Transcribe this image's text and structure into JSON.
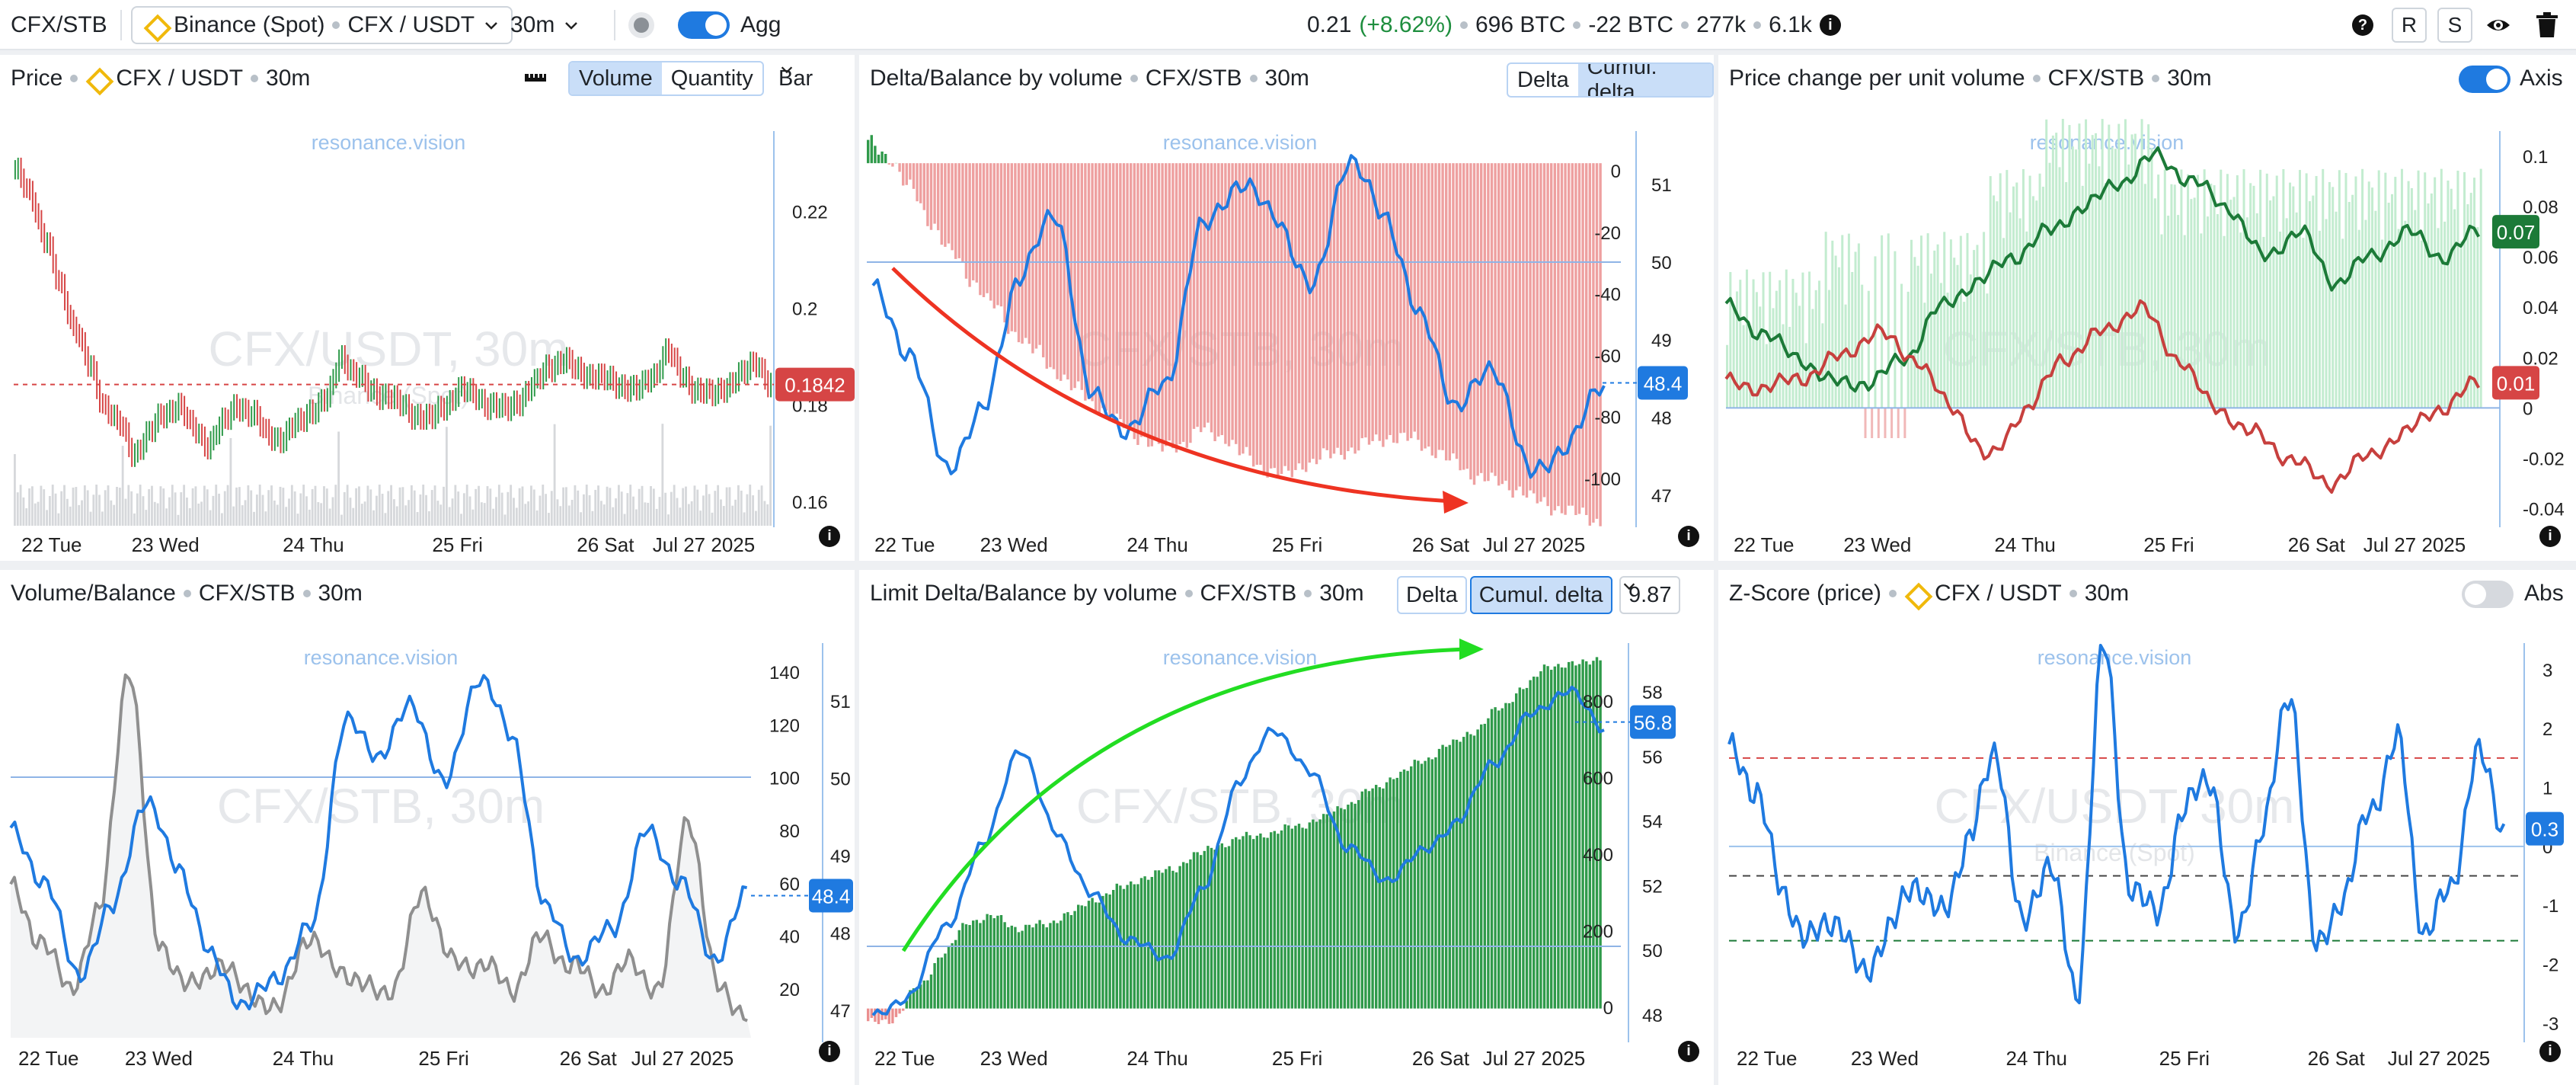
{
  "topbar": {
    "symbol": "CFX/STB",
    "exchange": "Binance (Spot)",
    "pair": "CFX / USDT",
    "timeframe": "30m",
    "agg_label": "Agg",
    "price": "0.21",
    "change": "(+8.62%)",
    "vol_btc": "696 BTC",
    "delta_btc": "-22 BTC",
    "trades": "277k",
    "oi": "6.1k",
    "btn_r": "R",
    "btn_s": "S",
    "help_icon": "?",
    "info_icon": "i",
    "colors": {
      "positive": "#1e8e3e",
      "accent": "#1f7ae0"
    }
  },
  "watermark": "resonance.vision",
  "panels": [
    {
      "id": "price",
      "title": "Price",
      "pair": "CFX / USDT",
      "tf": "30m",
      "buttons": [
        "Volume",
        "Quantity"
      ],
      "active_button": "Volume",
      "chart_type_label": "Bar",
      "bg_text": "CFX/USDT, 30m",
      "bg_sub": "Binance (Spot)",
      "price_tag": "0.1842"
    },
    {
      "id": "delta",
      "title": "Delta/Balance by volume",
      "pair": "CFX/STB",
      "tf": "30m",
      "buttons": [
        "Delta",
        "Cumul. delta"
      ],
      "active_button": "Cumul. delta",
      "bg_text": "CFX/STB, 30m",
      "value_tag": "48.4"
    },
    {
      "id": "pcu",
      "title": "Price change per unit volume",
      "pair": "CFX/STB",
      "tf": "30m",
      "toggle_label": "Axis",
      "bg_text": "CFX/STB, 30m",
      "tag_green": "0.07",
      "tag_red": "0.01"
    },
    {
      "id": "volbal",
      "title": "Volume/Balance",
      "pair": "CFX/STB",
      "tf": "30m",
      "bg_text": "CFX/STB, 30m",
      "value_tag": "48.4"
    },
    {
      "id": "limit",
      "title": "Limit Delta/Balance by volume",
      "pair": "CFX/STB",
      "tf": "30m",
      "buttons": [
        "Delta",
        "Cumul. delta"
      ],
      "active_button": "Cumul. delta",
      "dropdown": "9.87",
      "bg_text": "CFX/STB, 30m",
      "value_tag": "56.8"
    },
    {
      "id": "zscore",
      "title": "Z-Score (price)",
      "pair": "CFX / USDT",
      "tf": "30m",
      "toggle_label": "Abs",
      "bg_text": "CFX/USDT, 30m",
      "bg_sub": "Binance (Spot)",
      "value_tag": "0.3"
    }
  ],
  "chart_data": [
    {
      "type": "bar",
      "panel": "price",
      "x_ticks": [
        "22 Tue",
        "23 Wed",
        "24 Thu",
        "25 Fri",
        "26 Sat",
        "Jul 27 2025"
      ],
      "y_ticks": [
        "0.22",
        "0.2",
        "0.18",
        "0.16"
      ],
      "ylim": [
        0.155,
        0.235
      ],
      "series": [
        {
          "values": [
            0.228,
            0.224,
            0.214,
            0.205,
            0.196,
            0.188,
            0.18,
            0.176,
            0.17,
            0.174,
            0.178,
            0.18,
            0.175,
            0.172,
            0.176,
            0.18,
            0.178,
            0.174,
            0.173,
            0.176,
            0.179,
            0.181,
            0.19,
            0.186,
            0.183,
            0.182,
            0.18,
            0.178,
            0.177,
            0.18,
            0.183,
            0.182,
            0.18,
            0.179,
            0.181,
            0.184,
            0.188,
            0.189,
            0.187,
            0.186,
            0.185,
            0.184,
            0.183,
            0.186,
            0.191,
            0.186,
            0.183,
            0.182,
            0.184,
            0.186,
            0.189,
            0.184
          ]
        }
      ]
    },
    {
      "type": "bar",
      "panel": "delta",
      "x_ticks": [
        "22 Tue",
        "23 Wed",
        "24 Thu",
        "25 Fri",
        "26 Sat",
        "Jul 27 2025"
      ],
      "y_ticks_left": [
        "0",
        "-20",
        "-40",
        "-60",
        "-80",
        "-100"
      ],
      "y_ticks_right": [
        "51",
        "50",
        "49",
        "48",
        "47"
      ],
      "ylim": [
        -110,
        8
      ],
      "series": [
        {
          "values": [
            6,
            2,
            -8,
            -18,
            -28,
            -36,
            -44,
            -52,
            -58,
            -64,
            -70,
            -75,
            -80,
            -84,
            -88,
            -86,
            -82,
            -84,
            -90,
            -94,
            -96,
            -92,
            -90,
            -88,
            -86,
            -84,
            -85,
            -88,
            -92,
            -96,
            -98,
            -100,
            -104,
            -106,
            -108,
            -110
          ]
        },
        {
          "values": [
            49.6,
            48.8,
            47.3,
            48.0,
            49.8,
            50.6,
            48.2,
            47.8,
            48.4,
            50.4,
            51.0,
            50.6,
            49.6,
            51.3,
            50.6,
            49.2,
            48.1,
            48.6,
            47.2,
            47.6,
            48.4
          ]
        }
      ]
    },
    {
      "type": "line",
      "panel": "pcu",
      "x_ticks": [
        "22 Tue",
        "23 Wed",
        "24 Thu",
        "25 Fri",
        "26 Sat",
        "Jul 27 2025"
      ],
      "y_ticks": [
        "0.1",
        "0.08",
        "0.06",
        "0.04",
        "0.02",
        "0",
        "-0.02",
        "-0.04"
      ],
      "ylim": [
        -0.045,
        0.11
      ],
      "series": [
        {
          "values": [
            0.04,
            0.03,
            0.02,
            0.01,
            0.01,
            0.02,
            0.04,
            0.05,
            0.06,
            0.07,
            0.08,
            0.09,
            0.1,
            0.09,
            0.08,
            0.06,
            0.07,
            0.05,
            0.06,
            0.07,
            0.06,
            0.07
          ]
        },
        {
          "values": [
            0.01,
            0.008,
            0.012,
            0.02,
            0.03,
            0.02,
            0.0,
            -0.02,
            0.0,
            0.02,
            0.03,
            0.04,
            0.02,
            0.0,
            -0.01,
            -0.02,
            -0.03,
            -0.02,
            -0.01,
            0.0,
            0.01
          ]
        }
      ]
    },
    {
      "type": "line",
      "panel": "volbal",
      "x_ticks": [
        "22 Tue",
        "23 Wed",
        "24 Thu",
        "25 Fri",
        "26 Sat",
        "Jul 27 2025"
      ],
      "y_ticks_left": [
        "140",
        "120",
        "100",
        "80",
        "60",
        "40",
        "20"
      ],
      "y_ticks_right": [
        "51",
        "50",
        "49",
        "48",
        "47"
      ],
      "series": [
        {
          "values": [
            60,
            40,
            20,
            50,
            150,
            40,
            20,
            30,
            20,
            10,
            40,
            30,
            20,
            20,
            60,
            30,
            30,
            20,
            40,
            30,
            20,
            30,
            20,
            90,
            20,
            10
          ]
        },
        {
          "values": [
            49.2,
            48.6,
            47.4,
            48.2,
            49.6,
            48.8,
            47.6,
            47.0,
            47.4,
            48.0,
            50.6,
            50.2,
            50.8,
            49.8,
            51.2,
            50.4,
            48.2,
            47.6,
            48.0,
            49.2,
            48.6,
            47.6,
            48.4
          ]
        }
      ]
    },
    {
      "type": "bar",
      "panel": "limit",
      "x_ticks": [
        "22 Tue",
        "23 Wed",
        "24 Thu",
        "25 Fri",
        "26 Sat",
        "Jul 27 2025"
      ],
      "y_ticks_left": [
        "800",
        "600",
        "400",
        "200",
        "0"
      ],
      "y_ticks_right": [
        "58",
        "56",
        "54",
        "52",
        "50",
        "48"
      ],
      "ylim": [
        -80,
        1000
      ],
      "series": [
        {
          "values": [
            -40,
            -30,
            60,
            150,
            240,
            250,
            220,
            230,
            260,
            300,
            330,
            360,
            380,
            420,
            450,
            470,
            480,
            500,
            520,
            560,
            600,
            640,
            680,
            720,
            760,
            820,
            880,
            940,
            940,
            960
          ]
        },
        {
          "values": [
            47.8,
            48.5,
            50.6,
            53.0,
            56.0,
            53.5,
            51.5,
            50.2,
            49.6,
            51.6,
            55.0,
            56.6,
            55.2,
            53.0,
            52.0,
            52.8,
            53.8,
            55.6,
            57.0,
            57.8,
            56.6
          ]
        }
      ]
    },
    {
      "type": "line",
      "panel": "zscore",
      "x_ticks": [
        "22 Tue",
        "23 Wed",
        "24 Thu",
        "25 Fri",
        "26 Sat",
        "Jul 27 2025"
      ],
      "y_ticks": [
        "3",
        "2",
        "1",
        "0",
        "-1",
        "-2",
        "-3"
      ],
      "ylim": [
        -3.3,
        3.4
      ],
      "series": [
        {
          "values": [
            1.6,
            1.0,
            -0.8,
            -1.6,
            -1.2,
            -2.2,
            -1.4,
            -0.6,
            -1.2,
            0.2,
            1.6,
            -1.4,
            -0.2,
            -2.6,
            3.4,
            -0.6,
            -1.2,
            0.6,
            1.2,
            -1.6,
            0.4,
            2.6,
            -1.8,
            -0.8,
            0.6,
            1.8,
            -1.4,
            -0.8,
            1.6,
            0.3
          ]
        }
      ]
    }
  ]
}
